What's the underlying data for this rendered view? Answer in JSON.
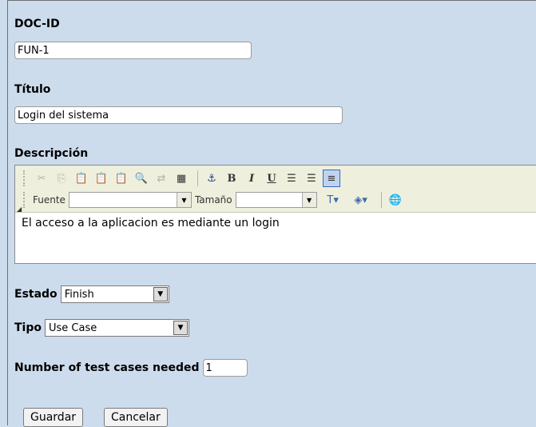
{
  "fields": {
    "docid": {
      "label": "DOC-ID",
      "value": "FUN-1"
    },
    "titulo": {
      "label": "Título",
      "value": "Login del sistema"
    },
    "descripcion": {
      "label": "Descripción",
      "content": "El acceso a la aplicacion es mediante un login",
      "toolbar": {
        "font_label": "Fuente",
        "size_label": "Tamaño",
        "font_value": "",
        "size_value": ""
      }
    },
    "estado": {
      "label": "Estado",
      "value": "Finish"
    },
    "tipo": {
      "label": "Tipo",
      "value": "Use Case"
    },
    "num_tests": {
      "label": "Number of test cases needed",
      "value": "1"
    }
  },
  "actions": {
    "save": "Guardar",
    "cancel": "Cancelar"
  },
  "icons": {
    "cut": "cut-icon",
    "copy": "copy-icon",
    "paste": "paste-icon",
    "paste_text": "paste-text-icon",
    "paste_word": "paste-word-icon",
    "find": "find-icon",
    "replace": "replace-icon",
    "select_all": "select-all-icon",
    "anchor": "anchor-icon",
    "bold": "bold-icon",
    "italic": "italic-icon",
    "underline": "underline-icon",
    "ordered_list": "ordered-list-icon",
    "unordered_list": "unordered-list-icon",
    "align_left": "align-left-icon",
    "text_color": "text-color-icon",
    "bg_color": "background-color-icon",
    "link": "link-icon"
  },
  "colors": {
    "background": "#ccdcec",
    "toolbar": "#efefde",
    "active_button": "#c1d2ee"
  }
}
